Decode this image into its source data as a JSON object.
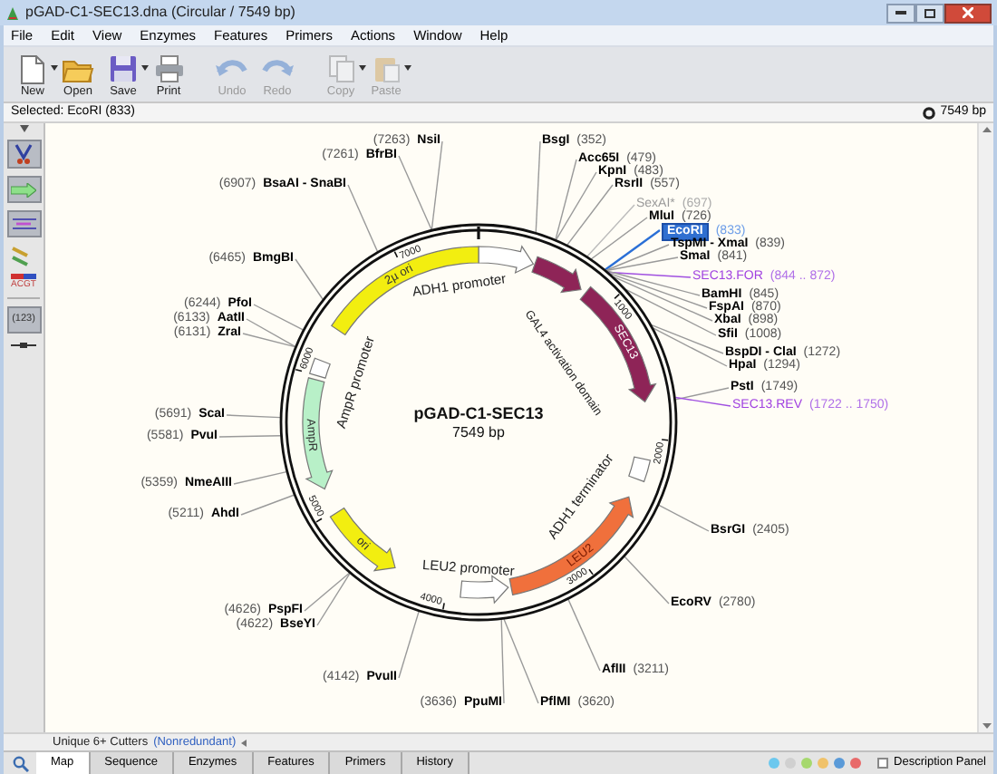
{
  "window": {
    "title": "pGAD-C1-SEC13.dna  (Circular / 7549 bp)"
  },
  "menu": [
    "File",
    "Edit",
    "View",
    "Enzymes",
    "Features",
    "Primers",
    "Actions",
    "Window",
    "Help"
  ],
  "toolbar": [
    {
      "label": "New",
      "disabled": false,
      "menu": true
    },
    {
      "label": "Open",
      "disabled": false,
      "menu": false
    },
    {
      "label": "Save",
      "disabled": false,
      "menu": true
    },
    {
      "label": "Print",
      "disabled": false,
      "menu": false
    },
    {
      "label": "Undo",
      "disabled": true,
      "menu": false
    },
    {
      "label": "Redo",
      "disabled": true,
      "menu": false
    },
    {
      "label": "Copy",
      "disabled": true,
      "menu": true
    },
    {
      "label": "Paste",
      "disabled": true,
      "menu": true
    }
  ],
  "selection_bar": {
    "selected": "Selected: EcoRI (833)",
    "length": "7549 bp"
  },
  "side_tools": [
    "ACGT",
    "(123)"
  ],
  "map": {
    "name": "pGAD-C1-SEC13",
    "length": "7549 bp",
    "ticks": [
      "1000",
      "2000",
      "3000",
      "4000",
      "5000",
      "6000",
      "7000"
    ],
    "features": [
      {
        "name": "ADH1 promoter",
        "color": "#ffffff"
      },
      {
        "name": "GAL4 activation domain",
        "color": "#8e2457"
      },
      {
        "name": "SEC13",
        "color": "#8e2457"
      },
      {
        "name": "ADH1 terminator",
        "color": "#ffffff"
      },
      {
        "name": "LEU2",
        "color": "#f0703c"
      },
      {
        "name": "LEU2 promoter",
        "color": "#ffffff"
      },
      {
        "name": "ori",
        "color": "#f2ee10"
      },
      {
        "name": "AmpR",
        "color": "#b8f0c8"
      },
      {
        "name": "AmpR promoter",
        "color": "#ffffff"
      },
      {
        "name": "2µ ori",
        "color": "#f2ee10"
      }
    ],
    "sites": [
      {
        "kind": "enzyme",
        "name": "BsgI",
        "position": "(352)",
        "selected": false,
        "dimmed": false
      },
      {
        "kind": "enzyme",
        "name": "Acc65I",
        "position": "(479)",
        "selected": false,
        "dimmed": false
      },
      {
        "kind": "enzyme",
        "name": "KpnI",
        "position": "(483)",
        "selected": false,
        "dimmed": false
      },
      {
        "kind": "enzyme",
        "name": "RsrII",
        "position": "(557)",
        "selected": false,
        "dimmed": false
      },
      {
        "kind": "enzyme",
        "name": "SexAI*",
        "position": "(697)",
        "selected": false,
        "dimmed": true
      },
      {
        "kind": "enzyme",
        "name": "MluI",
        "position": "(726)",
        "selected": false,
        "dimmed": false
      },
      {
        "kind": "enzyme",
        "name": "EcoRI",
        "position": "(833)",
        "selected": true,
        "dimmed": false
      },
      {
        "kind": "enzyme",
        "name": "TspMI - XmaI",
        "position": "(839)",
        "selected": false,
        "dimmed": false
      },
      {
        "kind": "enzyme",
        "name": "SmaI",
        "position": "(841)",
        "selected": false,
        "dimmed": false
      },
      {
        "kind": "primer",
        "name": "SEC13.FOR",
        "position": "(844 .. 872)",
        "selected": false,
        "dimmed": false
      },
      {
        "kind": "enzyme",
        "name": "BamHI",
        "position": "(845)",
        "selected": false,
        "dimmed": false
      },
      {
        "kind": "enzyme",
        "name": "FspAI",
        "position": "(870)",
        "selected": false,
        "dimmed": false
      },
      {
        "kind": "enzyme",
        "name": "XbaI",
        "position": "(898)",
        "selected": false,
        "dimmed": false
      },
      {
        "kind": "enzyme",
        "name": "SfiI",
        "position": "(1008)",
        "selected": false,
        "dimmed": false
      },
      {
        "kind": "enzyme",
        "name": "BspDI - ClaI",
        "position": "(1272)",
        "selected": false,
        "dimmed": false
      },
      {
        "kind": "enzyme",
        "name": "HpaI",
        "position": "(1294)",
        "selected": false,
        "dimmed": false
      },
      {
        "kind": "enzyme",
        "name": "PstI",
        "position": "(1749)",
        "selected": false,
        "dimmed": false
      },
      {
        "kind": "primer",
        "name": "SEC13.REV",
        "position": "(1722 .. 1750)",
        "selected": false,
        "dimmed": false
      },
      {
        "kind": "enzyme",
        "name": "BsrGI",
        "position": "(2405)",
        "selected": false,
        "dimmed": false
      },
      {
        "kind": "enzyme",
        "name": "EcoRV",
        "position": "(2780)",
        "selected": false,
        "dimmed": false
      },
      {
        "kind": "enzyme",
        "name": "AflII",
        "position": "(3211)",
        "selected": false,
        "dimmed": false
      },
      {
        "kind": "enzyme",
        "name": "PflMI",
        "position": "(3620)",
        "selected": false,
        "dimmed": false
      },
      {
        "kind": "enzyme",
        "name": "NsiI",
        "position": "(7263)",
        "selected": false,
        "dimmed": false
      },
      {
        "kind": "enzyme",
        "name": "BfrBI",
        "position": "(7261)",
        "selected": false,
        "dimmed": false
      },
      {
        "kind": "enzyme",
        "name": "BsaAI - SnaBI",
        "position": "(6907)",
        "selected": false,
        "dimmed": false
      },
      {
        "kind": "enzyme",
        "name": "BmgBI",
        "position": "(6465)",
        "selected": false,
        "dimmed": false
      },
      {
        "kind": "enzyme",
        "name": "PfoI",
        "position": "(6244)",
        "selected": false,
        "dimmed": false
      },
      {
        "kind": "enzyme",
        "name": "AatII",
        "position": "(6133)",
        "selected": false,
        "dimmed": false
      },
      {
        "kind": "enzyme",
        "name": "ZraI",
        "position": "(6131)",
        "selected": false,
        "dimmed": false
      },
      {
        "kind": "enzyme",
        "name": "ScaI",
        "position": "(5691)",
        "selected": false,
        "dimmed": false
      },
      {
        "kind": "enzyme",
        "name": "PvuI",
        "position": "(5581)",
        "selected": false,
        "dimmed": false
      },
      {
        "kind": "enzyme",
        "name": "NmeAIII",
        "position": "(5359)",
        "selected": false,
        "dimmed": false
      },
      {
        "kind": "enzyme",
        "name": "AhdI",
        "position": "(5211)",
        "selected": false,
        "dimmed": false
      },
      {
        "kind": "enzyme",
        "name": "PspFI",
        "position": "(4626)",
        "selected": false,
        "dimmed": false
      },
      {
        "kind": "enzyme",
        "name": "BseYI",
        "position": "(4622)",
        "selected": false,
        "dimmed": false
      },
      {
        "kind": "enzyme",
        "name": "PvuII",
        "position": "(4142)",
        "selected": false,
        "dimmed": false
      },
      {
        "kind": "enzyme",
        "name": "PpuMI",
        "position": "(3636)",
        "selected": false,
        "dimmed": false
      }
    ]
  },
  "enzyme_set": {
    "label": "Unique 6+ Cutters",
    "option": "(Nonredundant)"
  },
  "tabs": [
    {
      "label": "Map",
      "selected": true
    },
    {
      "label": "Sequence",
      "selected": false
    },
    {
      "label": "Enzymes",
      "selected": false
    },
    {
      "label": "Features",
      "selected": false
    },
    {
      "label": "Primers",
      "selected": false
    },
    {
      "label": "History",
      "selected": false
    }
  ],
  "color_filters": [
    {
      "color": "#6cc8ee"
    },
    {
      "color": "#d0d0d0"
    },
    {
      "color": "#a6d86e"
    },
    {
      "color": "#f0c26a"
    },
    {
      "color": "#5a9ad8"
    },
    {
      "color": "#e86a6a"
    }
  ],
  "description_panel": {
    "label": "Description Panel",
    "checked": false
  }
}
